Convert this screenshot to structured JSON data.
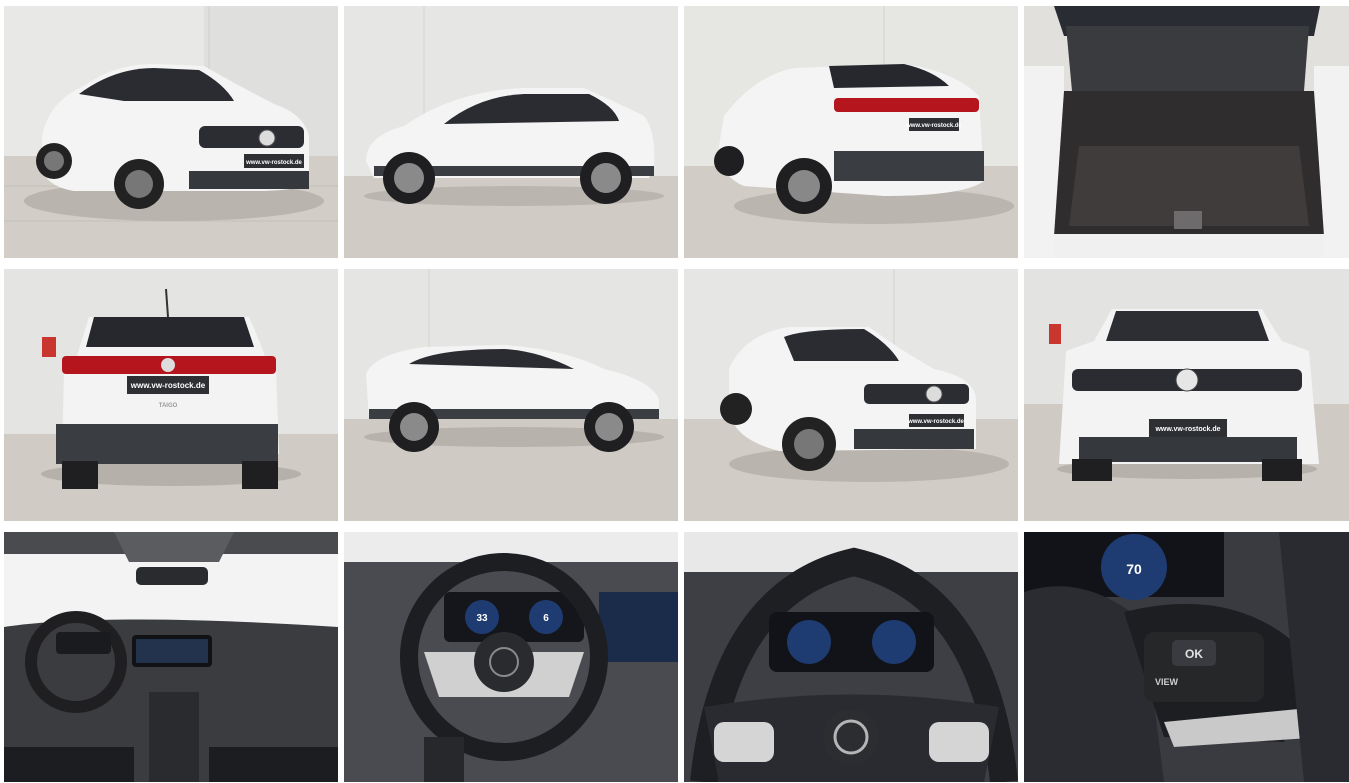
{
  "gallery": {
    "plate": "www.vw-rostock.de",
    "model_badge": "TAIGO",
    "dashboard": {
      "speed": "70",
      "ok_label": "OK",
      "view_label": "VIEW",
      "cluster_left": "33",
      "cluster_right": "6"
    },
    "photos": [
      {
        "view": "front-three-quarter-left"
      },
      {
        "view": "side-left"
      },
      {
        "view": "rear-three-quarter-left"
      },
      {
        "view": "trunk-open"
      },
      {
        "view": "rear"
      },
      {
        "view": "side-right"
      },
      {
        "view": "front-three-quarter-left-2"
      },
      {
        "view": "front"
      },
      {
        "view": "interior-dashboard"
      },
      {
        "view": "steering-wheel"
      },
      {
        "view": "steering-wheel-closeup"
      },
      {
        "view": "steering-controls-closeup"
      }
    ]
  },
  "colors": {
    "body_white": "#f4f4f4",
    "wall": "#e6e6e4",
    "floor": "#cfcac4",
    "trim_dark": "#3a3d42",
    "taillight": "#b5161e",
    "plate": "#2e2f33"
  }
}
